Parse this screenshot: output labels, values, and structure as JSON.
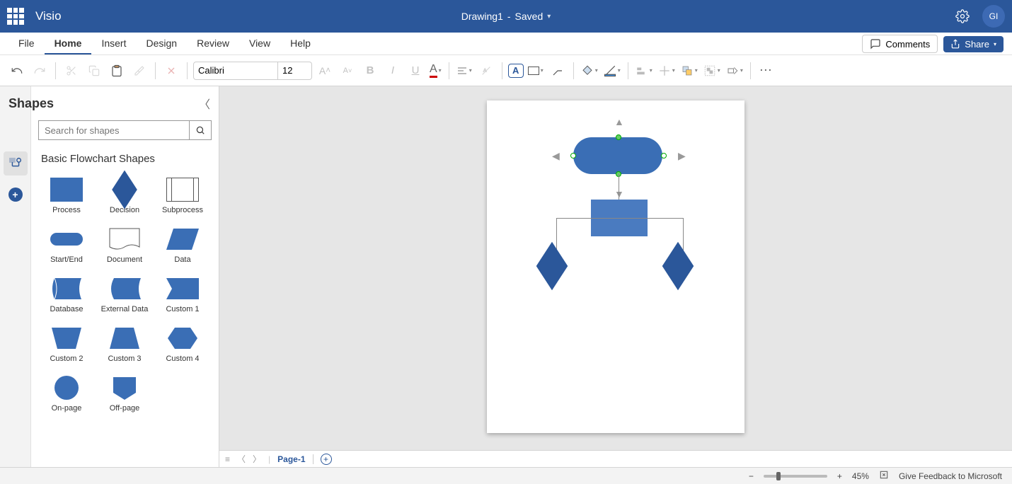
{
  "app": {
    "name": "Visio"
  },
  "title": {
    "doc_name": "Drawing1",
    "separator": "-",
    "status": "Saved"
  },
  "user": {
    "initials": "GI"
  },
  "menu": {
    "tabs": [
      "File",
      "Home",
      "Insert",
      "Design",
      "Review",
      "View",
      "Help"
    ],
    "active": 1,
    "comments_label": "Comments",
    "share_label": "Share"
  },
  "ribbon": {
    "font_name": "Calibri",
    "font_size": "12"
  },
  "shapes_panel": {
    "title": "Shapes",
    "search_placeholder": "Search for shapes",
    "stencil_title": "Basic Flowchart Shapes",
    "shapes": [
      {
        "label": "Process"
      },
      {
        "label": "Decision"
      },
      {
        "label": "Subprocess"
      },
      {
        "label": "Start/End"
      },
      {
        "label": "Document"
      },
      {
        "label": "Data"
      },
      {
        "label": "Database"
      },
      {
        "label": "External Data"
      },
      {
        "label": "Custom 1"
      },
      {
        "label": "Custom 2"
      },
      {
        "label": "Custom 3"
      },
      {
        "label": "Custom 4"
      },
      {
        "label": "On-page"
      },
      {
        "label": "Off-page"
      }
    ]
  },
  "page_tabs": {
    "current": "Page-1"
  },
  "status": {
    "zoom": "45%",
    "feedback": "Give Feedback to Microsoft"
  },
  "colors": {
    "accent": "#2b579a",
    "shape_fill": "#3a6eb5"
  }
}
